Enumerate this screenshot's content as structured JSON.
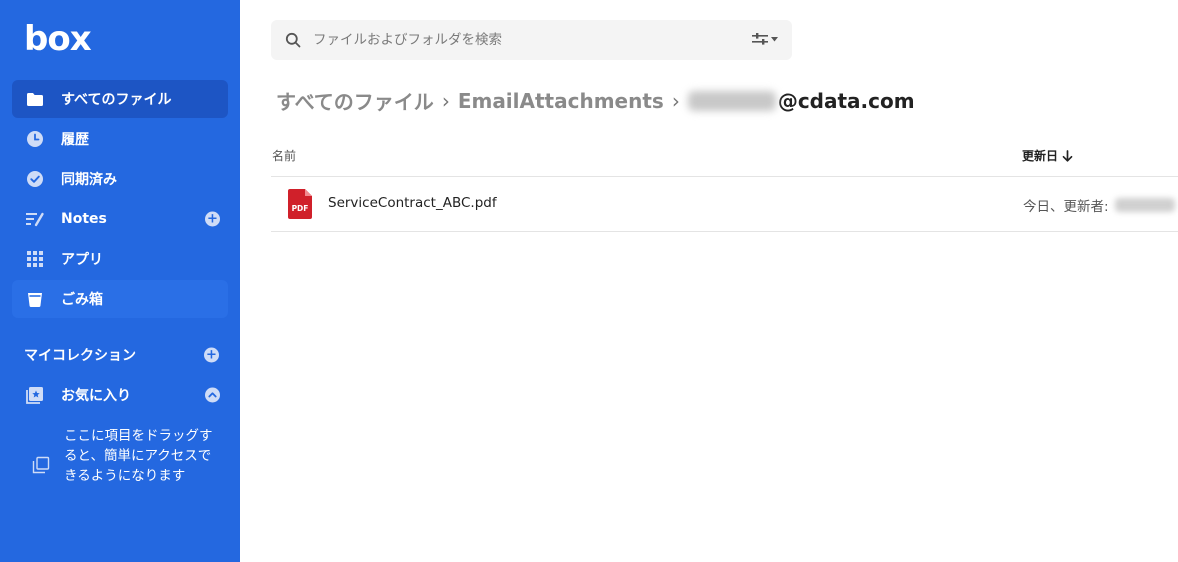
{
  "brand": {
    "logo_text": "box"
  },
  "sidebar": {
    "items": [
      {
        "label": "すべてのファイル",
        "icon": "folder-icon"
      },
      {
        "label": "履歴",
        "icon": "clock-icon"
      },
      {
        "label": "同期済み",
        "icon": "check-circle-icon"
      },
      {
        "label": "Notes",
        "icon": "notes-icon",
        "action": "+"
      },
      {
        "label": "アプリ",
        "icon": "grid-icon"
      },
      {
        "label": "ごみ箱",
        "icon": "trash-icon"
      }
    ],
    "collections_label": "マイコレクション",
    "collections_action": "+",
    "favorites_label": "お気に入り",
    "favorites_hint": "ここに項目をドラッグすると、簡単にアクセスできるようになります"
  },
  "search": {
    "placeholder": "ファイルおよびフォルダを検索"
  },
  "breadcrumb": {
    "root": "すべてのファイル",
    "folder": "EmailAttachments",
    "current_suffix": "@cdata.com"
  },
  "table": {
    "col_name": "名前",
    "col_date": "更新日",
    "rows": [
      {
        "name": "ServiceContract_ABC.pdf",
        "file_type": "PDF",
        "meta": "今日、更新者:"
      }
    ]
  },
  "colors": {
    "sidebar_bg": "#2468e0",
    "sidebar_active": "#1d55c4",
    "pdf_red": "#d0202a"
  }
}
